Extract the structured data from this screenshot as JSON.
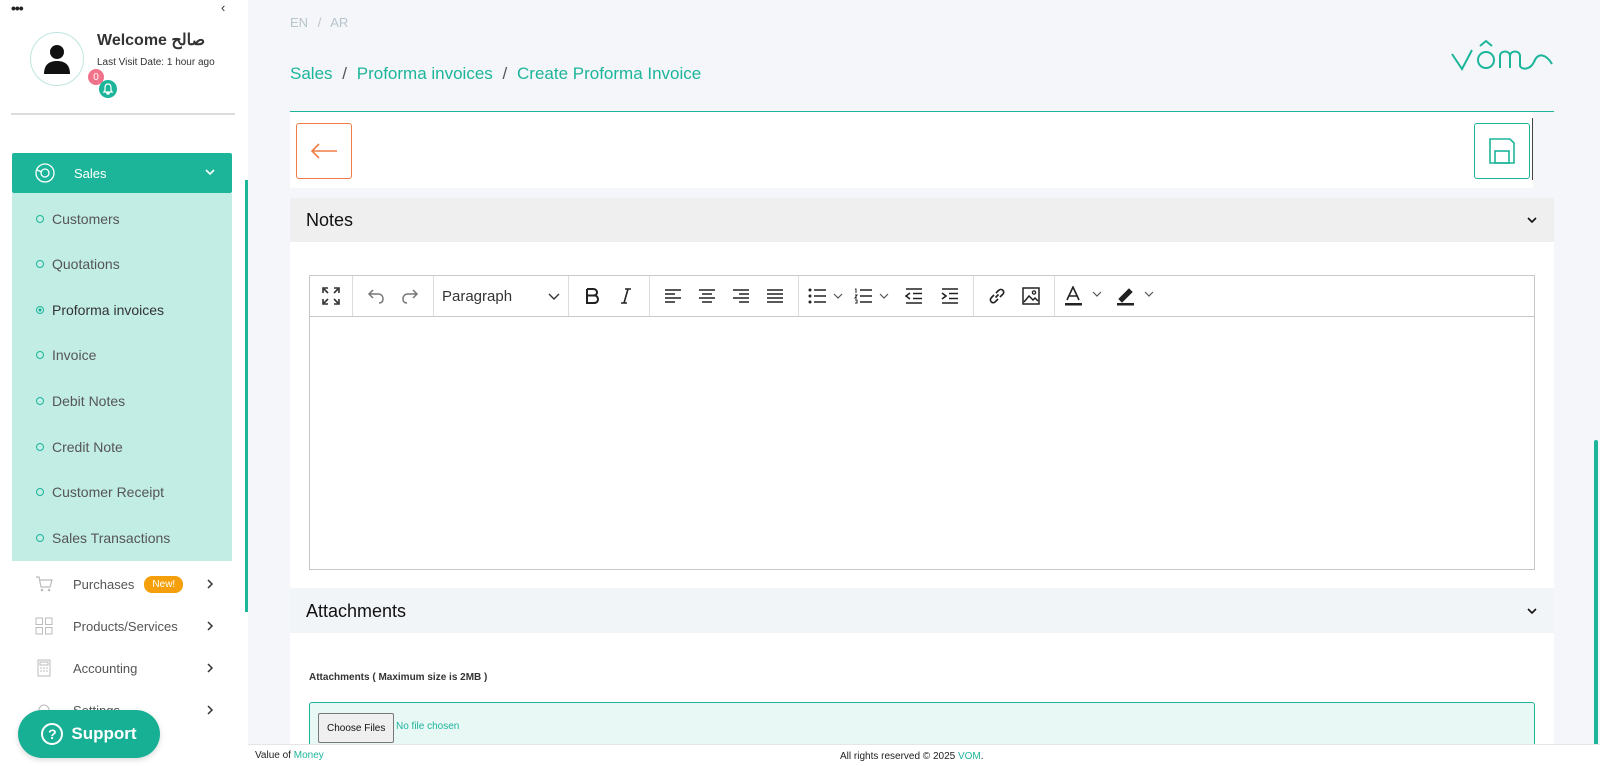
{
  "sidebar": {
    "dots": "•••",
    "collapse_icon": "chevron-left",
    "welcome": "Welcome صالح",
    "last_visit": "Last Visit Date: 1 hour ago",
    "notifications_count": "0",
    "sales_label": "Sales",
    "sales_submenu": [
      {
        "label": "Customers",
        "active": false
      },
      {
        "label": "Quotations",
        "active": false
      },
      {
        "label": "Proforma invoices",
        "active": true
      },
      {
        "label": "Invoice",
        "active": false
      },
      {
        "label": "Debit Notes",
        "active": false
      },
      {
        "label": "Credit Note",
        "active": false
      },
      {
        "label": "Customer Receipt",
        "active": false
      },
      {
        "label": "Sales Transactions",
        "active": false
      }
    ],
    "purchases_label": "Purchases",
    "purchases_badge": "New!",
    "products_label": "Products/Services",
    "accounting_label": "Accounting",
    "settings_label": "Settings",
    "support_label": "Support"
  },
  "header": {
    "lang_en": "EN",
    "lang_sep": "/",
    "lang_ar": "AR",
    "breadcrumb": [
      "Sales",
      "Proforma invoices",
      "Create Proforma Invoice"
    ],
    "crumb_sep": "/"
  },
  "notes": {
    "title": "Notes",
    "paragraph_select": "Paragraph"
  },
  "attachments": {
    "title": "Attachments",
    "label": "Attachments ( Maximum size is 2MB )",
    "choose_button": "Choose Files",
    "no_file": "No file chosen"
  },
  "footer": {
    "value_of": "Value of",
    "money": "Money",
    "rights": "All rights reserved © 2025",
    "brand": "VOM",
    "dot": "."
  },
  "colors": {
    "accent": "#1db59a",
    "back_button": "#ef7d45",
    "badge_new": "#f5a00a",
    "notif_badge": "#f0738b"
  }
}
